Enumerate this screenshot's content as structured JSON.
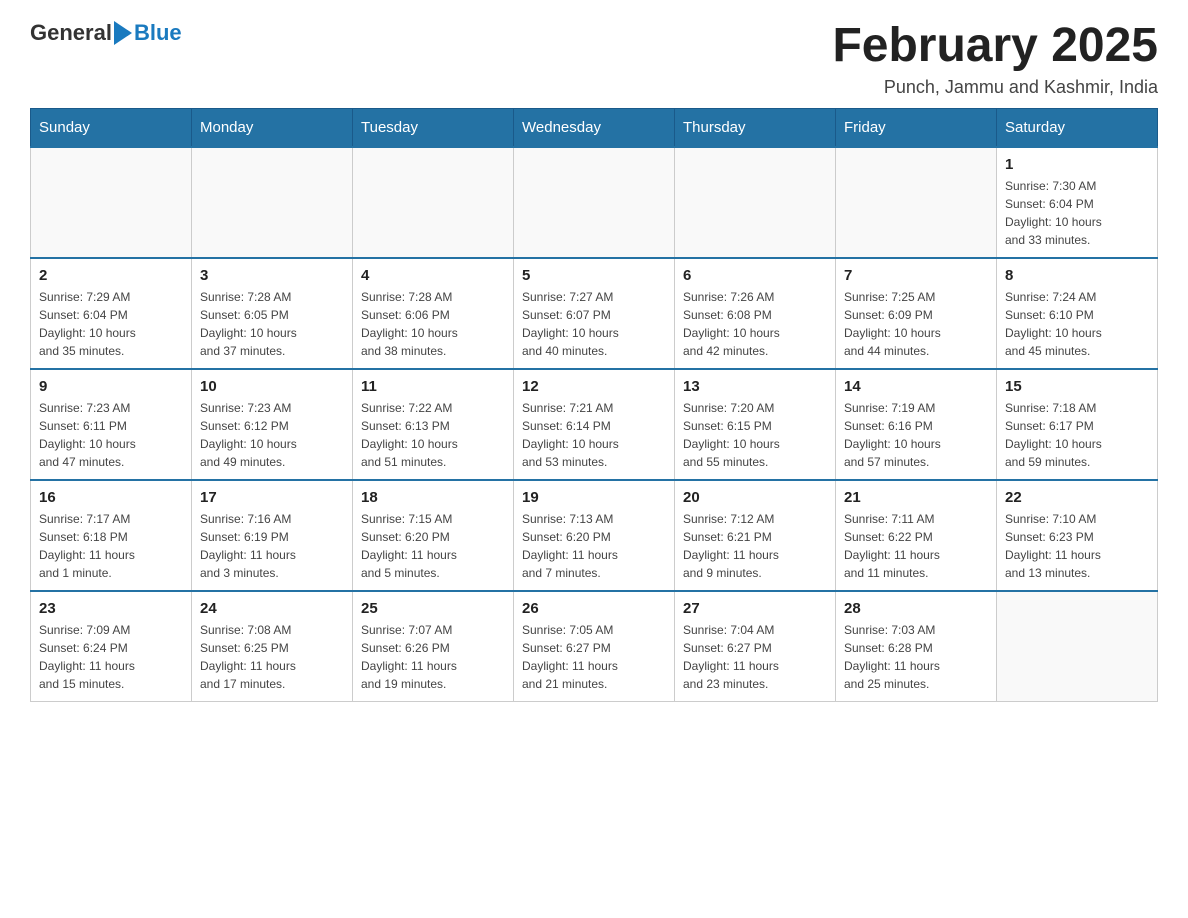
{
  "logo": {
    "general": "General",
    "blue": "Blue"
  },
  "title": "February 2025",
  "location": "Punch, Jammu and Kashmir, India",
  "days_of_week": [
    "Sunday",
    "Monday",
    "Tuesday",
    "Wednesday",
    "Thursday",
    "Friday",
    "Saturday"
  ],
  "weeks": [
    [
      {
        "day": "",
        "info": ""
      },
      {
        "day": "",
        "info": ""
      },
      {
        "day": "",
        "info": ""
      },
      {
        "day": "",
        "info": ""
      },
      {
        "day": "",
        "info": ""
      },
      {
        "day": "",
        "info": ""
      },
      {
        "day": "1",
        "info": "Sunrise: 7:30 AM\nSunset: 6:04 PM\nDaylight: 10 hours\nand 33 minutes."
      }
    ],
    [
      {
        "day": "2",
        "info": "Sunrise: 7:29 AM\nSunset: 6:04 PM\nDaylight: 10 hours\nand 35 minutes."
      },
      {
        "day": "3",
        "info": "Sunrise: 7:28 AM\nSunset: 6:05 PM\nDaylight: 10 hours\nand 37 minutes."
      },
      {
        "day": "4",
        "info": "Sunrise: 7:28 AM\nSunset: 6:06 PM\nDaylight: 10 hours\nand 38 minutes."
      },
      {
        "day": "5",
        "info": "Sunrise: 7:27 AM\nSunset: 6:07 PM\nDaylight: 10 hours\nand 40 minutes."
      },
      {
        "day": "6",
        "info": "Sunrise: 7:26 AM\nSunset: 6:08 PM\nDaylight: 10 hours\nand 42 minutes."
      },
      {
        "day": "7",
        "info": "Sunrise: 7:25 AM\nSunset: 6:09 PM\nDaylight: 10 hours\nand 44 minutes."
      },
      {
        "day": "8",
        "info": "Sunrise: 7:24 AM\nSunset: 6:10 PM\nDaylight: 10 hours\nand 45 minutes."
      }
    ],
    [
      {
        "day": "9",
        "info": "Sunrise: 7:23 AM\nSunset: 6:11 PM\nDaylight: 10 hours\nand 47 minutes."
      },
      {
        "day": "10",
        "info": "Sunrise: 7:23 AM\nSunset: 6:12 PM\nDaylight: 10 hours\nand 49 minutes."
      },
      {
        "day": "11",
        "info": "Sunrise: 7:22 AM\nSunset: 6:13 PM\nDaylight: 10 hours\nand 51 minutes."
      },
      {
        "day": "12",
        "info": "Sunrise: 7:21 AM\nSunset: 6:14 PM\nDaylight: 10 hours\nand 53 minutes."
      },
      {
        "day": "13",
        "info": "Sunrise: 7:20 AM\nSunset: 6:15 PM\nDaylight: 10 hours\nand 55 minutes."
      },
      {
        "day": "14",
        "info": "Sunrise: 7:19 AM\nSunset: 6:16 PM\nDaylight: 10 hours\nand 57 minutes."
      },
      {
        "day": "15",
        "info": "Sunrise: 7:18 AM\nSunset: 6:17 PM\nDaylight: 10 hours\nand 59 minutes."
      }
    ],
    [
      {
        "day": "16",
        "info": "Sunrise: 7:17 AM\nSunset: 6:18 PM\nDaylight: 11 hours\nand 1 minute."
      },
      {
        "day": "17",
        "info": "Sunrise: 7:16 AM\nSunset: 6:19 PM\nDaylight: 11 hours\nand 3 minutes."
      },
      {
        "day": "18",
        "info": "Sunrise: 7:15 AM\nSunset: 6:20 PM\nDaylight: 11 hours\nand 5 minutes."
      },
      {
        "day": "19",
        "info": "Sunrise: 7:13 AM\nSunset: 6:20 PM\nDaylight: 11 hours\nand 7 minutes."
      },
      {
        "day": "20",
        "info": "Sunrise: 7:12 AM\nSunset: 6:21 PM\nDaylight: 11 hours\nand 9 minutes."
      },
      {
        "day": "21",
        "info": "Sunrise: 7:11 AM\nSunset: 6:22 PM\nDaylight: 11 hours\nand 11 minutes."
      },
      {
        "day": "22",
        "info": "Sunrise: 7:10 AM\nSunset: 6:23 PM\nDaylight: 11 hours\nand 13 minutes."
      }
    ],
    [
      {
        "day": "23",
        "info": "Sunrise: 7:09 AM\nSunset: 6:24 PM\nDaylight: 11 hours\nand 15 minutes."
      },
      {
        "day": "24",
        "info": "Sunrise: 7:08 AM\nSunset: 6:25 PM\nDaylight: 11 hours\nand 17 minutes."
      },
      {
        "day": "25",
        "info": "Sunrise: 7:07 AM\nSunset: 6:26 PM\nDaylight: 11 hours\nand 19 minutes."
      },
      {
        "day": "26",
        "info": "Sunrise: 7:05 AM\nSunset: 6:27 PM\nDaylight: 11 hours\nand 21 minutes."
      },
      {
        "day": "27",
        "info": "Sunrise: 7:04 AM\nSunset: 6:27 PM\nDaylight: 11 hours\nand 23 minutes."
      },
      {
        "day": "28",
        "info": "Sunrise: 7:03 AM\nSunset: 6:28 PM\nDaylight: 11 hours\nand 25 minutes."
      },
      {
        "day": "",
        "info": ""
      }
    ]
  ]
}
